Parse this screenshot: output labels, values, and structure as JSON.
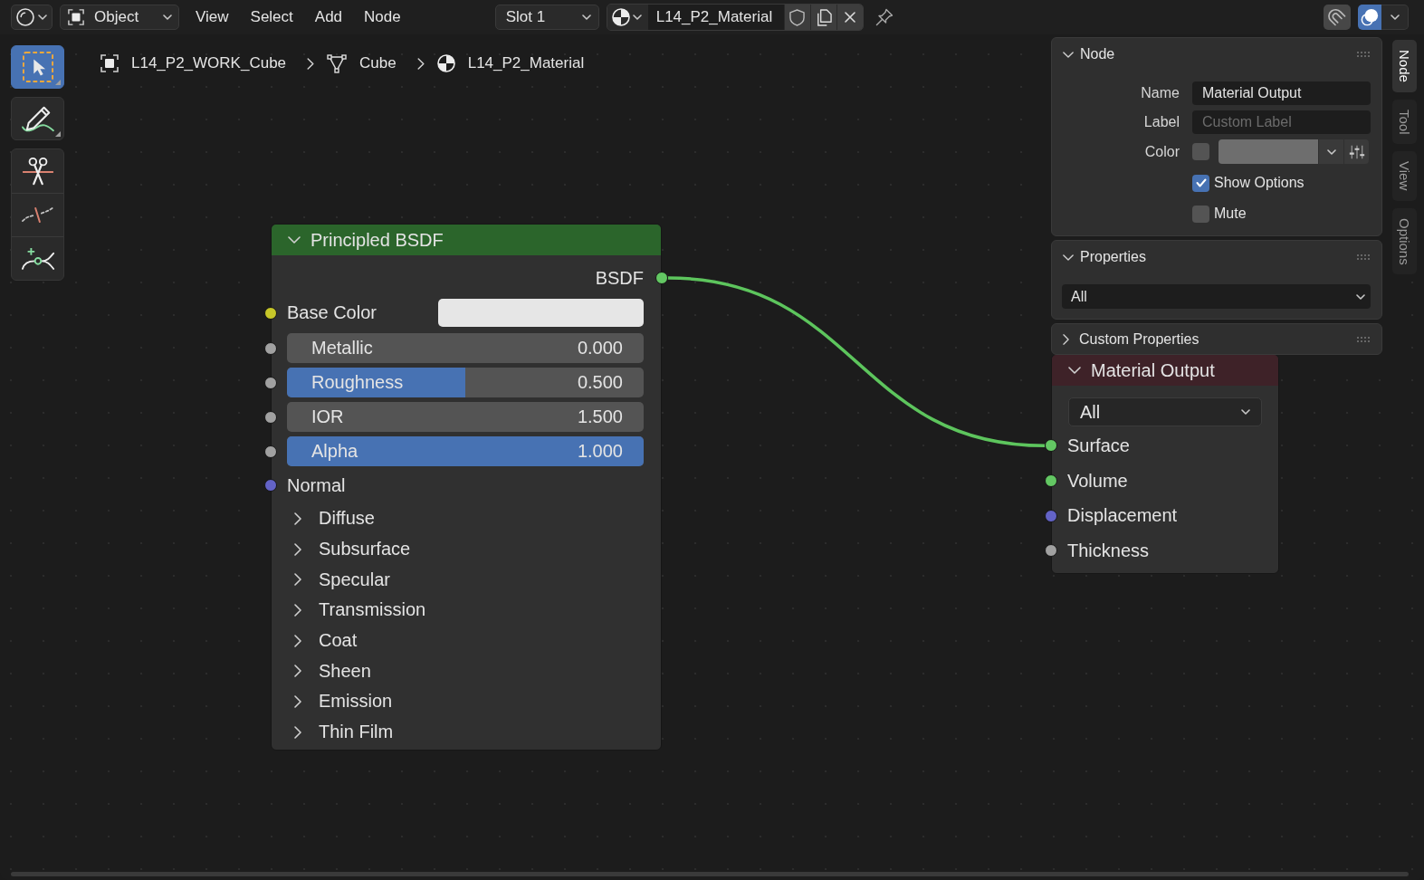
{
  "header": {
    "mode": {
      "label": "Object"
    },
    "menus": [
      {
        "label": "View"
      },
      {
        "label": "Select"
      },
      {
        "label": "Add"
      },
      {
        "label": "Node"
      }
    ],
    "slot": {
      "label": "Slot 1"
    },
    "material": {
      "value": "L14_P2_Material"
    },
    "toggles": [
      {
        "kind": "snap",
        "on": false
      },
      {
        "kind": "overlays",
        "on": true
      }
    ]
  },
  "toolbar": {
    "groups": [
      {
        "tools": [
          {
            "kind": "select_box",
            "selected": true
          }
        ]
      },
      {
        "tools": [
          {
            "kind": "annotate",
            "selected": false
          }
        ]
      },
      {
        "tools": [
          {
            "kind": "cut_links",
            "selected": false
          },
          {
            "kind": "mute_links",
            "selected": false
          },
          {
            "kind": "add_reroute",
            "selected": false
          }
        ]
      }
    ]
  },
  "breadcrumbs": [
    {
      "kind": "object",
      "label": "L14_P2_WORK_Cube"
    },
    {
      "kind": "mesh",
      "label": "Cube"
    },
    {
      "kind": "material",
      "label": "L14_P2_Material"
    }
  ],
  "nodes": [
    {
      "kind": "shader",
      "title": "Principled BSDF",
      "expanded": true,
      "outputs": [
        {
          "label": "BSDF",
          "color": "#63c763",
          "linked": true
        }
      ],
      "inputs": [
        {
          "kind": "color",
          "label": "Base Color",
          "color": "#c7c729",
          "swatch": {
            "color": "#e6e6e6"
          }
        },
        {
          "kind": "factor",
          "label": "Metallic",
          "value": "0.000",
          "level": 0,
          "color": "#a1a1a1"
        },
        {
          "kind": "factor",
          "label": "Roughness",
          "value": "0.500",
          "level": 0.5,
          "color": "#a1a1a1"
        },
        {
          "kind": "number",
          "label": "IOR",
          "value": "1.500",
          "color": "#a1a1a1"
        },
        {
          "kind": "factor",
          "label": "Alpha",
          "value": "1.000",
          "level": 1,
          "color": "#a1a1a1"
        },
        {
          "kind": "plain",
          "label": "Normal",
          "color": "#6363c7"
        }
      ],
      "panels": [
        {
          "label": "Diffuse",
          "expanded": false
        },
        {
          "label": "Subsurface",
          "expanded": false
        },
        {
          "label": "Specular",
          "expanded": false
        },
        {
          "label": "Transmission",
          "expanded": false
        },
        {
          "label": "Coat",
          "expanded": false
        },
        {
          "label": "Sheen",
          "expanded": false
        },
        {
          "label": "Emission",
          "expanded": false
        },
        {
          "label": "Thin Film",
          "expanded": false
        }
      ]
    },
    {
      "kind": "output",
      "title": "Material Output",
      "expanded": true,
      "target": "All",
      "inputs": [
        {
          "kind": "plain",
          "label": "Surface",
          "color": "#63c763",
          "linked": true
        },
        {
          "kind": "plain",
          "label": "Volume",
          "color": "#63c763",
          "linked": false
        },
        {
          "kind": "plain",
          "label": "Displacement",
          "color": "#6363c7",
          "linked": false
        },
        {
          "kind": "plain",
          "label": "Thickness",
          "color": "#a1a1a1",
          "linked": false
        }
      ]
    }
  ],
  "sidebar": {
    "panels": [
      {
        "title": "Node",
        "expanded": true,
        "fields": [
          {
            "kind": "text",
            "label": "Name",
            "value": "Material Output"
          },
          {
            "kind": "text",
            "label": "Label",
            "placeholder": "Custom Label"
          },
          {
            "kind": "color",
            "label": "Color",
            "checked": false,
            "swatch": {
              "color": "#6e6e6e"
            }
          },
          {
            "kind": "checkbox",
            "label": "Show Options",
            "checked": true
          },
          {
            "kind": "checkbox",
            "label": "Mute",
            "checked": false
          }
        ]
      },
      {
        "title": "Properties",
        "expanded": true,
        "dropdown": "All"
      },
      {
        "title": "Custom Properties",
        "expanded": false
      }
    ],
    "tabs": [
      {
        "label": "Node",
        "selected": true
      },
      {
        "label": "Tool",
        "selected": false
      },
      {
        "label": "View",
        "selected": false
      },
      {
        "label": "Options",
        "selected": false
      }
    ]
  }
}
